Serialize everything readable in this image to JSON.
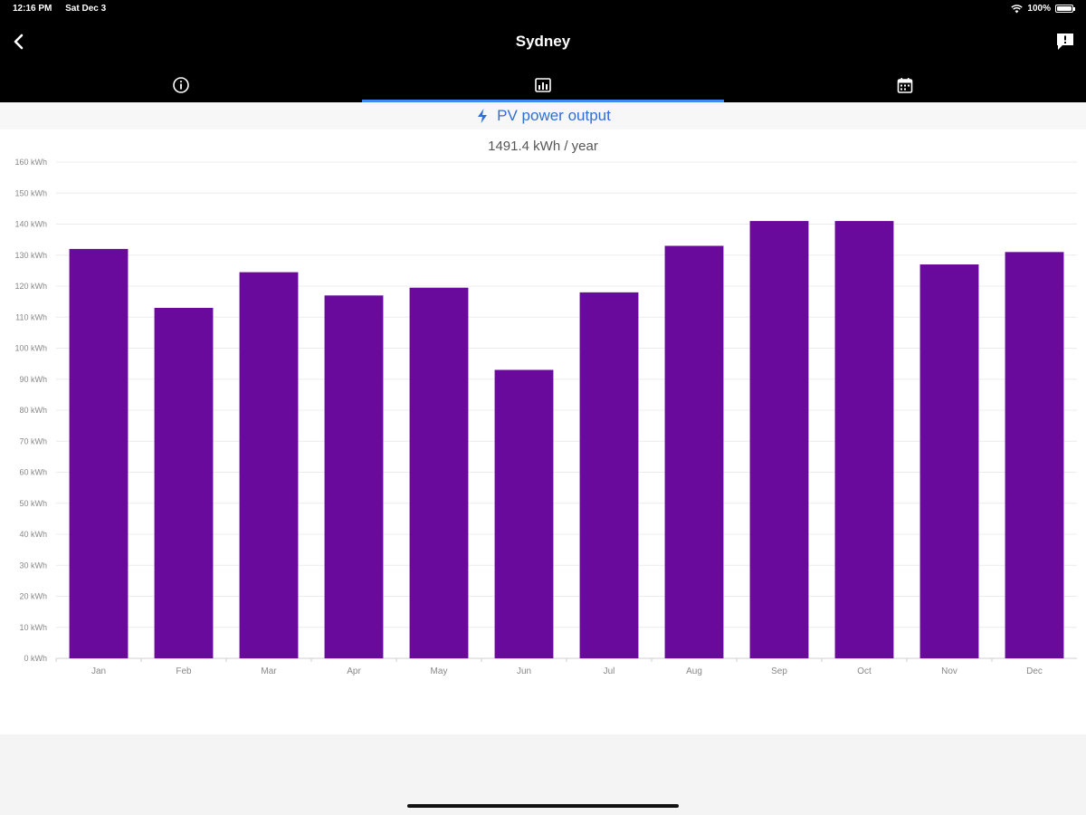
{
  "status_bar": {
    "time": "12:16 PM",
    "date": "Sat Dec 3",
    "battery": "100%"
  },
  "header": {
    "title": "Sydney"
  },
  "tabs": [
    {
      "icon": "info-icon",
      "active": false
    },
    {
      "icon": "chart-icon",
      "active": true
    },
    {
      "icon": "calendar-icon",
      "active": false
    }
  ],
  "section": {
    "title": "PV power output",
    "icon": "lightning-icon"
  },
  "summary": "1491.4 kWh / year",
  "colors": {
    "bar": "#6a0a9c",
    "accent": "#2f6fd6",
    "tab_indicator": "#3d8bf0"
  },
  "chart_data": {
    "type": "bar",
    "title": "",
    "categories": [
      "Jan",
      "Feb",
      "Mar",
      "Apr",
      "May",
      "Jun",
      "Jul",
      "Aug",
      "Sep",
      "Oct",
      "Nov",
      "Dec"
    ],
    "values": [
      132,
      113,
      124.5,
      117,
      119.5,
      93,
      118,
      133,
      141,
      141,
      127,
      131
    ],
    "ylim": [
      0,
      160
    ],
    "yticks": [
      "0 kWh",
      "10 kWh",
      "20 kWh",
      "30 kWh",
      "40 kWh",
      "50 kWh",
      "60 kWh",
      "70 kWh",
      "80 kWh",
      "90 kWh",
      "100 kWh",
      "110 kWh",
      "120 kWh",
      "130 kWh",
      "140 kWh",
      "150 kWh",
      "160 kWh"
    ],
    "grid": true,
    "legend": "none"
  }
}
